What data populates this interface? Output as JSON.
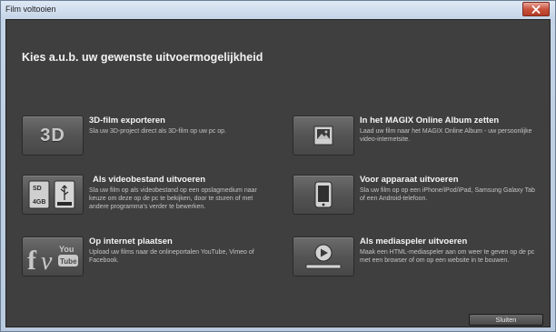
{
  "window": {
    "title": "Film voltooien"
  },
  "heading": "Kies a.u.b. uw gewenste uitvoermogelijkheid",
  "options": [
    {
      "title": "3D-film exporteren",
      "description": "Sla uw 3D-project direct als 3D-film op uw pc op.",
      "icon": "3d-icon",
      "icon_text": "3D"
    },
    {
      "title": "In het MAGIX Online Album zetten",
      "description": "Laad uw film naar het MAGIX Online Album - uw persoonlijke video-internetsite.",
      "icon": "photo-album-icon"
    },
    {
      "title": "Als videobestand uitvoeren",
      "description": "Sla uw film op als videobestand op een opslagmedium naar keuze om deze op de pc te bekijken, door te sturen of met andere programma's verder te bewerken.",
      "icon": "storage-media-icon",
      "icon_text_sd": "SD",
      "icon_text_gb": "4GB"
    },
    {
      "title": "Voor apparaat uitvoeren",
      "description": "Sla uw film op op een iPhone/iPod/iPad, Samsung Galaxy Tab of een Android-telefoon.",
      "icon": "phone-icon"
    },
    {
      "title": "Op internet plaatsen",
      "description": "Upload uw films naar de onlineportalen YouTube, Vimeo of Facebook.",
      "icon": "social-media-icon",
      "icon_text_f": "f",
      "icon_text_v": "v",
      "icon_text_you": "You",
      "icon_text_tube": "Tube"
    },
    {
      "title": "Als mediaspeler uitvoeren",
      "description": "Maak een HTML-mediaspeler aan om weer te geven op de pc met een browser of om op een website in te bouwen.",
      "icon": "media-player-icon"
    }
  ],
  "close_button_label": "Sluiten",
  "colors": {
    "panel_bg": "#3f3f3f",
    "tile_icon_bg": "#545454",
    "text_primary": "#f4f4f4",
    "text_secondary": "#c4c4c4"
  }
}
